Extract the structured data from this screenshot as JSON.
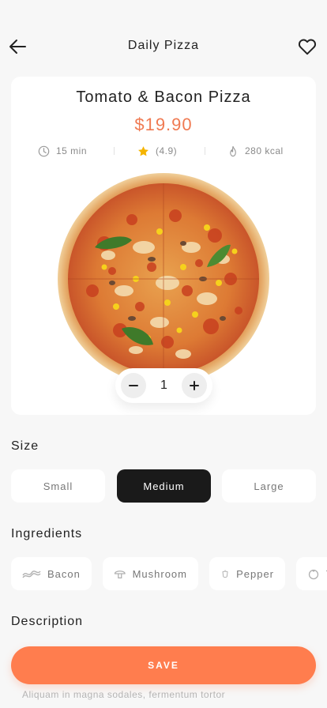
{
  "header": {
    "title": "Daily Pizza",
    "back_icon": "arrow-left-icon",
    "favorite_icon": "heart-icon"
  },
  "product": {
    "name": "Tomato & Bacon Pizza",
    "price": "$19.90",
    "time": "15 min",
    "rating": "(4.9)",
    "calories": "280 kcal",
    "quantity": "1"
  },
  "size": {
    "title": "Size",
    "options": [
      "Small",
      "Medium",
      "Large"
    ],
    "selected": "Medium"
  },
  "ingredients": {
    "title": "Ingredients",
    "items": [
      {
        "label": "Bacon",
        "icon": "bacon-icon"
      },
      {
        "label": "Mushroom",
        "icon": "mushroom-icon"
      },
      {
        "label": "Pepper",
        "icon": "pepper-icon"
      },
      {
        "label": "T",
        "icon": "tomato-icon"
      }
    ]
  },
  "description": {
    "title": "Description",
    "text": "Aliquam in magna sodales, fermentum tortor"
  },
  "actions": {
    "save_label": "SAVE"
  },
  "colors": {
    "accent": "#ff7d4e",
    "price": "#f07a52",
    "selected_chip": "#1a1a1a",
    "background": "#f7f7f7"
  }
}
